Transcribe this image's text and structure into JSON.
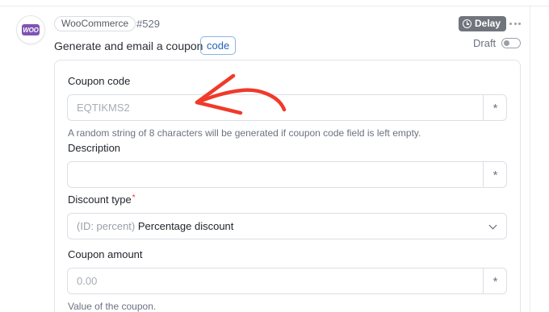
{
  "step": {
    "app_tag": "WooCommerce",
    "number": "#529",
    "title": "Generate and email a coupon",
    "chip": "code",
    "delay_label": "Delay",
    "draft_label": "Draft",
    "logo_text": "WOO",
    "brand_color": "#7f54b3",
    "icons": {
      "delay": "clock-icon",
      "more": "more-dots-icon",
      "logo": "woocommerce-logo"
    }
  },
  "form": {
    "coupon_code": {
      "label": "Coupon code",
      "placeholder": "EQTIKMS2",
      "help": "A random string of 8 characters will be generated if coupon code field is left empty.",
      "token_symbol": "*"
    },
    "description": {
      "label": "Description",
      "value": "",
      "token_symbol": "*"
    },
    "discount_type": {
      "label": "Discount type",
      "required_mark": "*",
      "value_prefix": "(ID: percent)",
      "value_text": "Percentage discount"
    },
    "coupon_amount": {
      "label": "Coupon amount",
      "placeholder": "0.00",
      "help": "Value of the coupon.",
      "token_symbol": "*"
    }
  },
  "annotation": {
    "arrow_color": "#f03a2a"
  }
}
